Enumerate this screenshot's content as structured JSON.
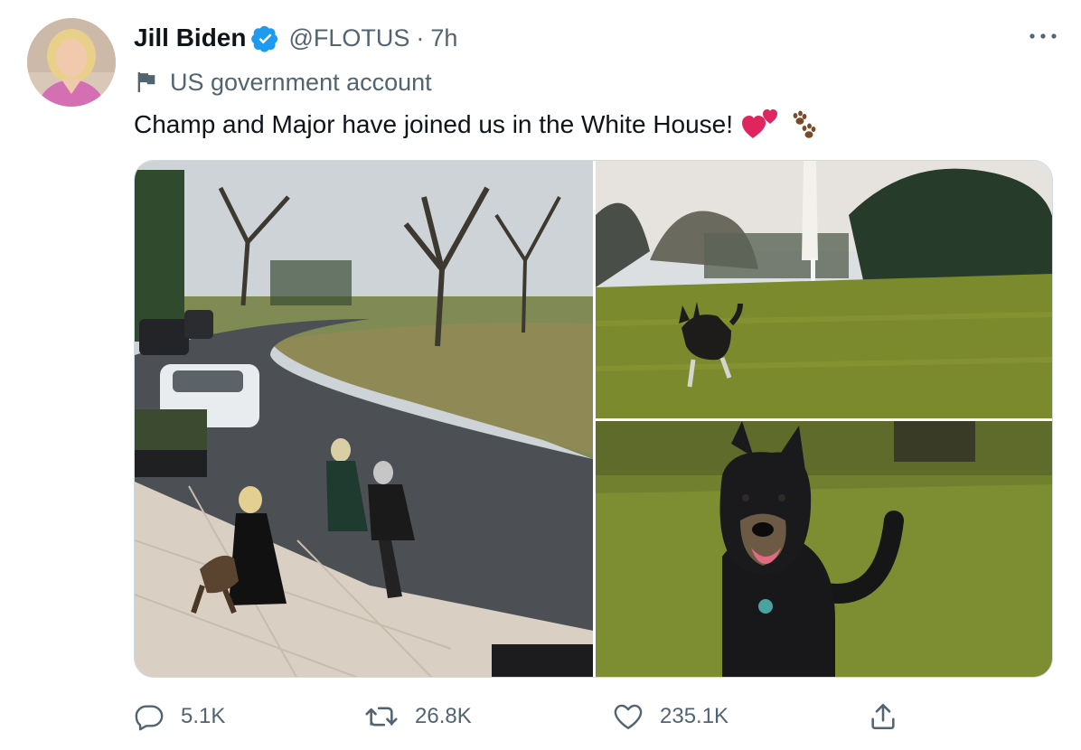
{
  "author": {
    "display_name": "Jill Biden",
    "handle": "@FLOTUS",
    "separator": "·",
    "timestamp": "7h",
    "verified": true,
    "label": "US government account"
  },
  "tweet": {
    "text": "Champ and Major have joined us in the White House!",
    "emojis": [
      "two-hearts-icon",
      "paw-prints-icon"
    ]
  },
  "media": {
    "photos": [
      {
        "name": "photo-champ-walk"
      },
      {
        "name": "photo-major-lawn"
      },
      {
        "name": "photo-major-closeup"
      }
    ]
  },
  "actions": {
    "reply_count": "5.1K",
    "retweet_count": "26.8K",
    "like_count": "235.1K"
  },
  "colors": {
    "verified_blue": "#1d9bf0",
    "text_primary": "#0f1419",
    "text_secondary": "#536471",
    "heart_red": "#e0245e",
    "paw_brown": "#7b4a28"
  },
  "icons": {
    "more": "more-icon",
    "verified": "verified-icon",
    "government_label": "flag-icon",
    "reply": "reply-icon",
    "retweet": "retweet-icon",
    "like": "like-icon",
    "share": "share-icon"
  }
}
